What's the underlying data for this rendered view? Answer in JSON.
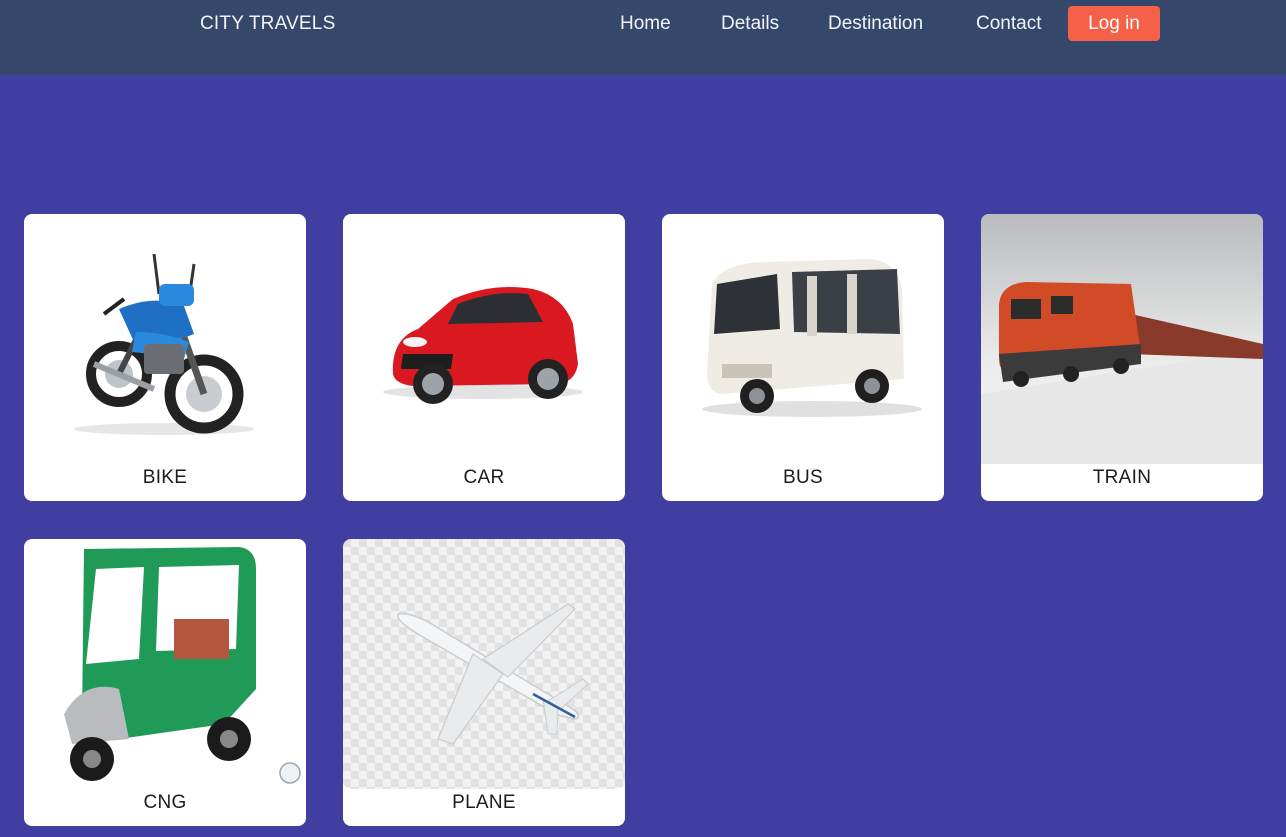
{
  "navbar": {
    "brand": "CITY TRAVELS",
    "links": [
      "Home",
      "Details",
      "Destination",
      "Contact"
    ],
    "login_label": "Log in",
    "bg_color": "#35486b",
    "login_color": "#f56049"
  },
  "page": {
    "bg_color": "#403ea0"
  },
  "cards": [
    {
      "label": "BIKE",
      "image": "motorcycle-image"
    },
    {
      "label": "CAR",
      "image": "car-image"
    },
    {
      "label": "BUS",
      "image": "bus-image"
    },
    {
      "label": "TRAIN",
      "image": "train-image"
    },
    {
      "label": "CNG",
      "image": "auto-rickshaw-image"
    },
    {
      "label": "PLANE",
      "image": "airplane-image"
    }
  ]
}
